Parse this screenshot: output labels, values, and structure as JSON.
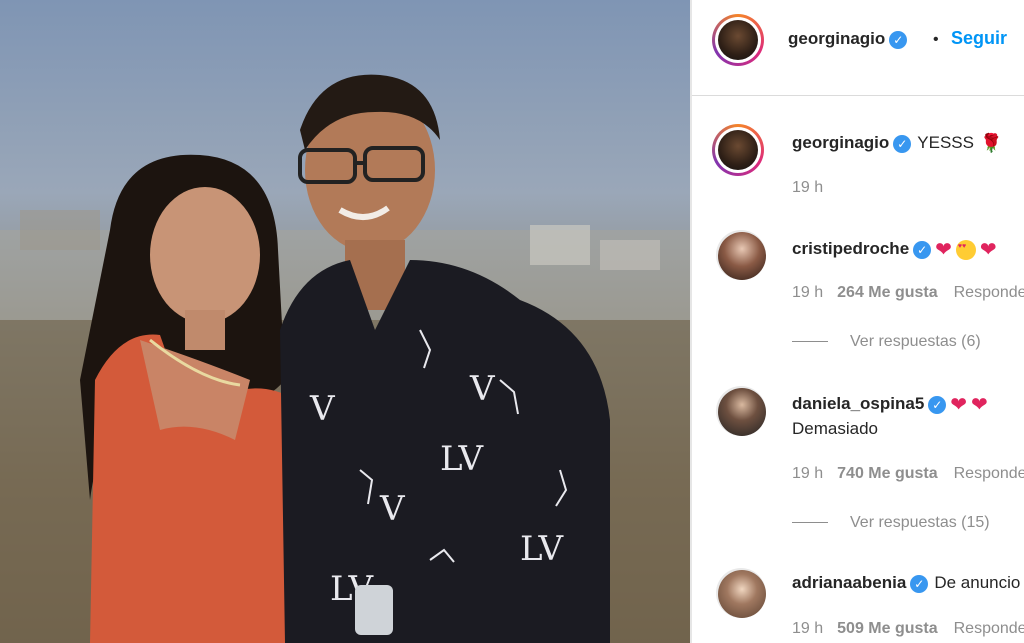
{
  "post": {
    "author": "georginagio",
    "follow_label": "Seguir",
    "separator": "•"
  },
  "caption": {
    "username": "georginagio",
    "text": "YESSS",
    "time": "19 h"
  },
  "comments": [
    {
      "username": "cristipedroche",
      "text": "",
      "time": "19 h",
      "likes": "264 Me gusta",
      "reply": "Responder",
      "view_replies": "Ver respuestas (6)"
    },
    {
      "username": "daniela_ospina5",
      "text": "Demasiado",
      "time": "19 h",
      "likes": "740 Me gusta",
      "reply": "Responder",
      "view_replies": "Ver respuestas (15)"
    },
    {
      "username": "adrianaabenia",
      "text": "De anuncio",
      "time": "19 h",
      "likes": "509 Me gusta",
      "reply": "Responder"
    }
  ],
  "colors": {
    "link_blue": "#0095f6",
    "verified_blue": "#3897f0",
    "secondary_text": "#8e8e8e",
    "heart_red": "#e0245e"
  }
}
